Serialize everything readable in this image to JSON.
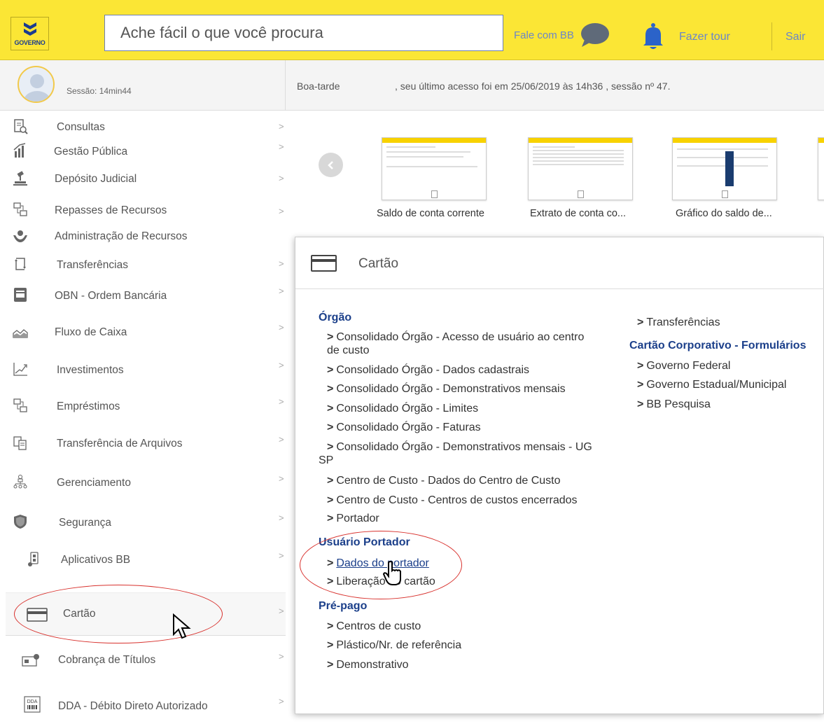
{
  "header": {
    "logo_text": "GOVERNO",
    "search_placeholder": "Ache fácil o que você procura",
    "fale_label": "Fale com BB",
    "tour_label": "Fazer tour",
    "sair_label": "Sair"
  },
  "session": {
    "label": "Sessão: 14min44",
    "greeting": "Boa-tarde",
    "last_access": ", seu último acesso foi em 25/06/2019 às 14h36 , sessão nº 47."
  },
  "sidebar": {
    "items": [
      {
        "label": "Consultas",
        "icon": "receipt-search-icon"
      },
      {
        "label": "Gestão Pública",
        "icon": "building-chart-icon"
      },
      {
        "label": "Depósito Judicial",
        "icon": "gavel-icon"
      },
      {
        "label": "Repasses de Recursos",
        "icon": "transfer-boxes-icon"
      },
      {
        "label": "Administração de Recursos",
        "icon": "hands-coin-icon"
      },
      {
        "label": "Transferências",
        "icon": "refresh-arrows-icon"
      },
      {
        "label": "OBN - Ordem Bancária",
        "icon": "bank-document-icon"
      },
      {
        "label": "Fluxo de Caixa",
        "icon": "area-chart-icon"
      },
      {
        "label": "Investimentos",
        "icon": "growth-chart-icon"
      },
      {
        "label": "Empréstimos",
        "icon": "transfer-boxes-icon"
      },
      {
        "label": "Transferência de Arquivos",
        "icon": "files-icon"
      },
      {
        "label": "Gerenciamento",
        "icon": "people-hierarchy-icon"
      },
      {
        "label": "Segurança",
        "icon": "shield-icon"
      },
      {
        "label": "Aplicativos BB",
        "icon": "mobile-app-icon"
      },
      {
        "label": "Cartão",
        "icon": "credit-card-icon"
      },
      {
        "label": "Cobrança de Títulos",
        "icon": "billing-icon"
      },
      {
        "label": "DDA - Débito Direto Autorizado",
        "icon": "dda-barcode-icon"
      }
    ]
  },
  "carousel": {
    "items": [
      {
        "caption": "Saldo de conta corrente"
      },
      {
        "caption": "Extrato de conta co..."
      },
      {
        "caption": "Gráfico do saldo de..."
      }
    ]
  },
  "panel": {
    "title": "Cartão",
    "left": {
      "orgao_title": "Órgão",
      "orgao_links": [
        "Consolidado Órgão - Acesso de usuário ao centro",
        "de custo",
        "Consolidado Órgão - Dados cadastrais",
        "Consolidado Órgão - Demonstrativos mensais",
        "Consolidado Órgão - Limites",
        "Consolidado Órgão - Faturas",
        "Consolidado Órgão - Demonstrativos mensais - UG",
        "SP",
        "Centro de Custo - Dados do Centro de Custo",
        "Centro de Custo - Centros de custos encerrados",
        "Portador"
      ],
      "usuario_title": "Usuário Portador",
      "usuario_links": [
        "Dados do portador",
        "Liberação do cartão"
      ],
      "prepago_title": "Pré-pago",
      "prepago_links": [
        "Centros de custo",
        "Plástico/Nr. de referência",
        "Demonstrativo"
      ]
    },
    "right": {
      "top_link": "Transferências",
      "corp_title": "Cartão Corporativo - Formulários",
      "corp_links": [
        "Governo Federal",
        "Governo Estadual/Municipal",
        "BB Pesquisa"
      ]
    }
  },
  "colors": {
    "header_yellow": "#fbe635",
    "link_blue": "#6a86c9",
    "section_blue": "#1b3f8a",
    "annotation_red": "#d8312d"
  }
}
